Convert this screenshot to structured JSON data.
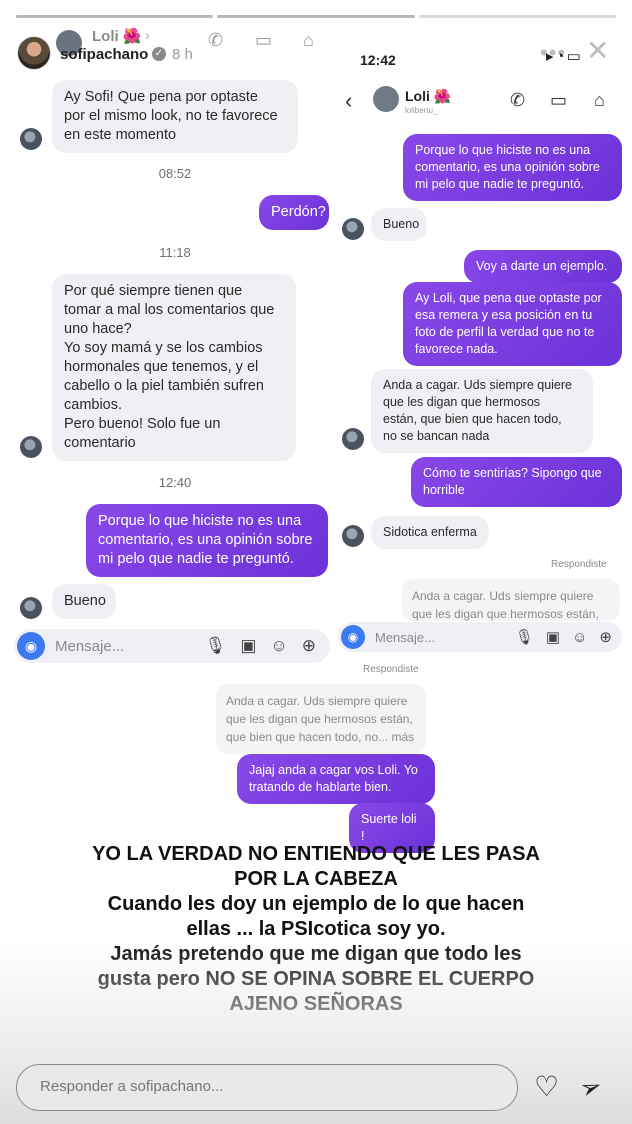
{
  "story": {
    "username": "sofipachano",
    "time_ago": "8 h",
    "more_label": "•••",
    "close_label": "✕",
    "reply_placeholder": "Responder a sofipachano..."
  },
  "left_chat": {
    "contact_name": "Loli 🌺",
    "messages": {
      "m1": "Ay Sofi! Que pena por optaste\npor el mismo look, no te favorece\nen este momento",
      "t1": "08:52",
      "m2": "Perdón?",
      "t2": "11:18",
      "m3": "Por qué siempre tienen que\ntomar a mal los comentarios que\nuno hace?\nYo soy mamá y se los cambios\nhormonales que tenemos, y el\ncabello o la piel también sufren\ncambios.\nPero bueno! Solo fue un\ncomentario",
      "t3": "12:40",
      "m4": "Porque lo que hiciste no es una\ncomentario, es una opinión sobre\nmi pelo que nadie te preguntó.",
      "m5": "Bueno"
    },
    "input_placeholder": "Mensaje..."
  },
  "right_chat": {
    "status_time": "12:42",
    "contact_name": "Loli 🌺",
    "contact_handle": "lolibertu_",
    "messages": {
      "r1": "Porque lo que hiciste no es una\ncomentario, es una opinión sobre\nmi pelo que nadie te preguntó.",
      "r2": "Bueno",
      "r3": "Voy a darte un ejemplo.",
      "r4": "Ay Loli, que pena que optaste por\nesa remera y esa posición en tu\nfoto de perfil la verdad que no te\nfavorece nada.",
      "r5": "Anda a cagar. Uds siempre quiere\nque les digan que hermosos\nestán, que bien que hacen todo,\nno se bancan nada",
      "r6": "Cómo te sentirías? Sipongo que\nhorrible",
      "r7": "Sidotica enferma"
    },
    "replied_label": "Respondiste",
    "quote_preview": "Anda a cagar. Uds siempre quiere\nque les digan que hermosos están,",
    "input_placeholder": "Mensaje..."
  },
  "bottom_chat": {
    "replied_label": "Respondiste",
    "quote": "Anda a cagar. Uds siempre quiere\nque les digan que hermosos están,\nque bien que hacen todo, no... más",
    "b1": "Jajaj anda a cagar vos Loli. Yo\ntratando de hablarte bien.",
    "b2": "Suerte loli !"
  },
  "caption": "YO LA VERDAD NO ENTIENDO QUE LES PASA\nPOR LA CABEZA\nCuando les doy un ejemplo de lo que hacen\nellas ... la PSIcotica soy yo.\nJamás pretendo que me digan que todo les\ngusta pero NO SE OPINA SOBRE EL CUERPO\nAJENO SEÑORAS",
  "colors": {
    "outgoing_bubble": "#7a3fe0",
    "incoming_bubble": "#eef0f4",
    "camera_button": "#3d7af0"
  },
  "icons": [
    "phone-icon",
    "video-icon",
    "tag-icon",
    "camera-icon",
    "mic-icon",
    "image-icon",
    "sticker-icon",
    "plus-icon",
    "heart-icon",
    "send-icon",
    "back-icon",
    "verified-icon"
  ]
}
